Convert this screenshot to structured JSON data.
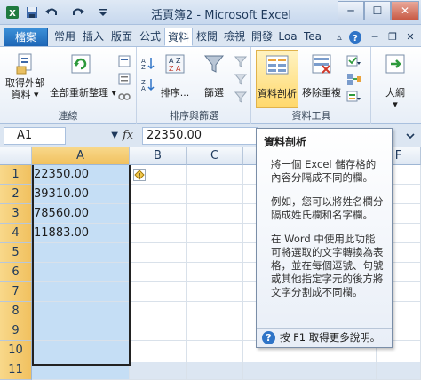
{
  "window": {
    "title": "活頁簿2 - Microsoft Excel",
    "minimize": "─",
    "maximize": "☐",
    "close": "✕"
  },
  "tabs": [
    {
      "label": "檔案"
    },
    {
      "label": "常用"
    },
    {
      "label": "插入"
    },
    {
      "label": "版面"
    },
    {
      "label": "公式"
    },
    {
      "label": "資料"
    },
    {
      "label": "校閱"
    },
    {
      "label": "檢視"
    },
    {
      "label": "開發"
    },
    {
      "label": "Loa"
    },
    {
      "label": "Tea"
    }
  ],
  "ribbon": {
    "groups": {
      "connections": "連線",
      "sort_filter": "排序與篩選",
      "data_tools": "資料工具"
    },
    "buttons": {
      "get_external": [
        "取得外部",
        "資料 ▾"
      ],
      "refresh_all": "全部重新整理 ▾",
      "sort": "排序...",
      "filter": "篩選",
      "text_to_columns": "資料剖析",
      "remove_duplicates": "移除重複",
      "outline": "大綱",
      "outline_sub": "▾"
    }
  },
  "formula_bar": {
    "name_box": "A1",
    "fx": "fx",
    "value": "22350.00"
  },
  "grid": {
    "columns": [
      "A",
      "B",
      "C",
      "F"
    ],
    "rows": [
      "1",
      "2",
      "3",
      "4",
      "5",
      "6",
      "7",
      "8",
      "9",
      "10",
      "11"
    ],
    "cells_a": [
      "22350.00",
      "39310.00",
      "78560.00",
      "11883.00"
    ]
  },
  "tooltip": {
    "title": "資料剖析",
    "p1": "將一個 Excel 儲存格的內容分隔成不同的欄。",
    "p2": "例如，您可以將姓名欄分隔成姓氏欄和名字欄。",
    "p3": "在 Word 中使用此功能可將選取的文字轉換為表格，並在每個逗號、句號或其他指定字元的後方將文字分割成不同欄。",
    "help": "按 F1 取得更多說明。",
    "help_icon": "?"
  },
  "colors": {
    "accent": "#2f74c7",
    "selection": "#c5def5",
    "highlight": "#ffd86b"
  }
}
